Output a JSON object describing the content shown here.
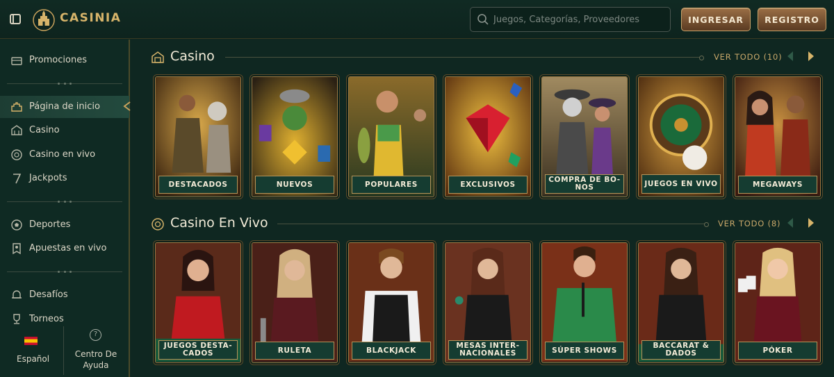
{
  "header": {
    "logo_text": "CASINIA",
    "search_placeholder": "Juegos, Categorías, Proveedores",
    "login_label": "INGRESAR",
    "register_label": "REGISTRO"
  },
  "sidebar": {
    "items": [
      {
        "label": "Promociones",
        "icon": "gift-box-icon"
      },
      {
        "label": "Página de inicio",
        "icon": "home-icon",
        "active": true
      },
      {
        "label": "Casino",
        "icon": "casino-icon"
      },
      {
        "label": "Casino en vivo",
        "icon": "live-casino-icon"
      },
      {
        "label": "Jackpots",
        "icon": "seven-icon"
      },
      {
        "label": "Deportes",
        "icon": "soccer-ball-icon"
      },
      {
        "label": "Apuestas en vivo",
        "icon": "live-bet-icon"
      },
      {
        "label": "Desafíos",
        "icon": "bell-icon"
      },
      {
        "label": "Torneos",
        "icon": "trophy-icon"
      }
    ],
    "language": "Español",
    "help_label": "Centro De Ayuda"
  },
  "sections": [
    {
      "title": "Casino",
      "see_all": "VER TODO (10)",
      "cards": [
        {
          "label": "DESTACADOS",
          "color": "#6b4a1c"
        },
        {
          "label": "NUEVOS",
          "color": "#4a3a20"
        },
        {
          "label": "POPULARES",
          "color": "#3d4a26"
        },
        {
          "label": "EXCLUSIVOS",
          "color": "#7a4a12"
        },
        {
          "label": "COMPRA DE BO-NOS",
          "color": "#5a4a35"
        },
        {
          "label": "JUEGOS EN VIVO",
          "color": "#6a4a18"
        },
        {
          "label": "MEGAWAYS",
          "color": "#5a2f1c"
        }
      ]
    },
    {
      "title": "Casino En Vivo",
      "see_all": "VER TODO (8)",
      "cards": [
        {
          "label": "JUEGOS DESTA-CADOS",
          "color": "#6a2a18"
        },
        {
          "label": "RULETA",
          "color": "#5a2418"
        },
        {
          "label": "BLACKJACK",
          "color": "#6a2c18"
        },
        {
          "label": "MESAS INTER-NACIONALES",
          "color": "#6a2e1c"
        },
        {
          "label": "SÚPER SHOWS",
          "color": "#6e2a16"
        },
        {
          "label": "BACCARAT & DADOS",
          "color": "#6a2a18"
        },
        {
          "label": "PÓKER",
          "color": "#5e2418"
        }
      ]
    }
  ]
}
